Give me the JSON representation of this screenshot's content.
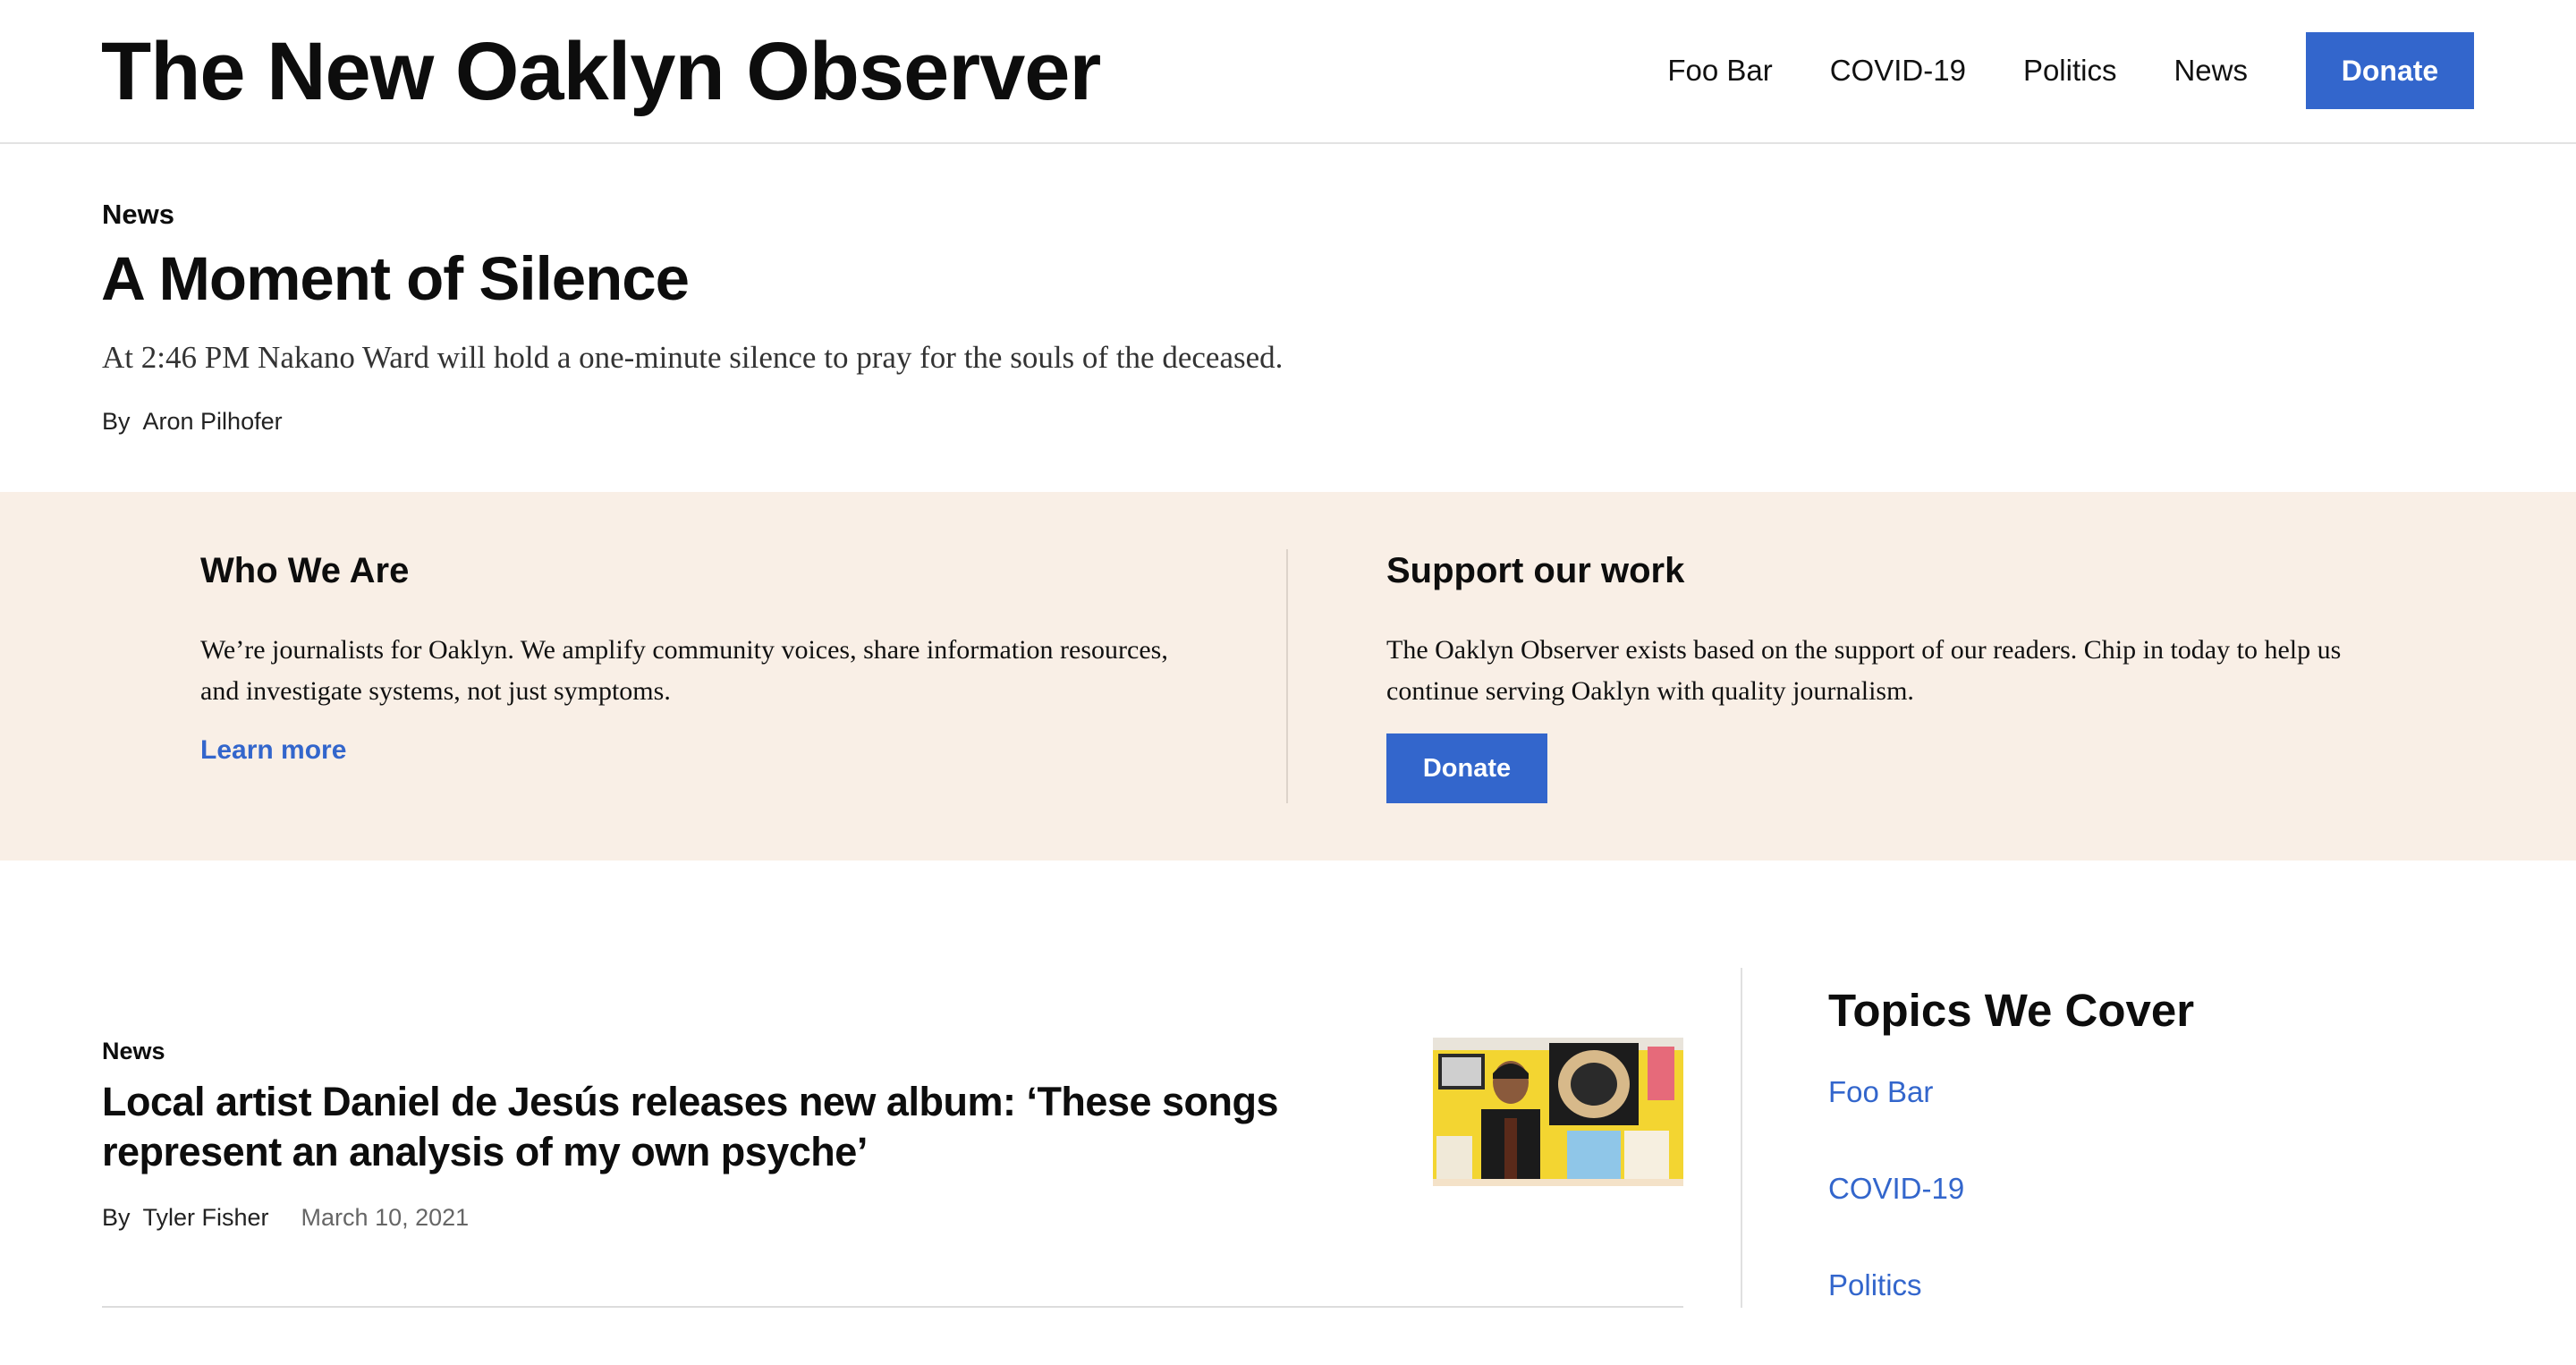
{
  "header": {
    "site_title": "The New Oaklyn Observer",
    "nav": [
      {
        "label": "Foo Bar"
      },
      {
        "label": "COVID-19"
      },
      {
        "label": "Politics"
      },
      {
        "label": "News"
      }
    ],
    "donate_label": "Donate"
  },
  "feature": {
    "kicker": "News",
    "headline": "A Moment of Silence",
    "dek": "At 2:46 PM Nakano Ward will hold a one-minute silence to pray for the souls of the deceased.",
    "byline_prefix": "By",
    "author": "Aron Pilhofer"
  },
  "promo": {
    "who": {
      "heading": "Who We Are",
      "body": "We’re journalists for Oaklyn. We amplify community voices, share information resources, and investigate systems, not just symptoms.",
      "link_label": "Learn more"
    },
    "support": {
      "heading": "Support our work",
      "body": "The Oaklyn Observer exists based on the support of our readers. Chip in today to help us continue serving Oaklyn with quality journalism.",
      "button_label": "Donate"
    }
  },
  "articles": [
    {
      "kicker": "News",
      "headline": "Local artist Daniel de Jesús releases new album: ‘These songs represent an analysis of my own psyche’",
      "byline_prefix": "By",
      "author": "Tyler Fisher",
      "date": "March 10, 2021"
    }
  ],
  "sidebar": {
    "title": "Topics We Cover",
    "topics": [
      {
        "label": "Foo Bar"
      },
      {
        "label": "COVID-19"
      },
      {
        "label": "Politics"
      }
    ]
  },
  "colors": {
    "accent": "#3366cc",
    "promo_background": "#f9efe6"
  }
}
